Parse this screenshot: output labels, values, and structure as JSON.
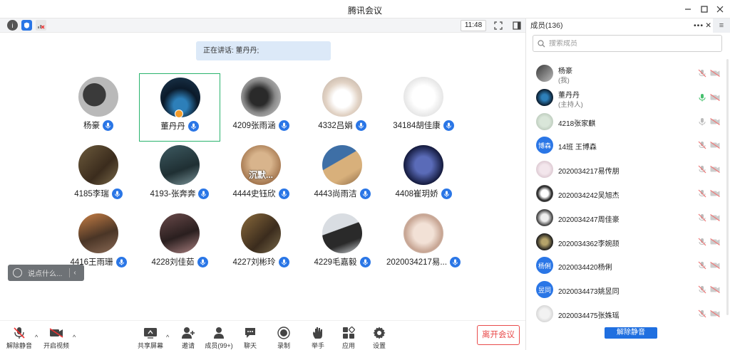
{
  "window": {
    "title": "腾讯会议"
  },
  "meeting": {
    "timer": "11:48",
    "speaking_label": "正在讲话: 董丹丹;"
  },
  "participants": [
    {
      "name": "杨豪"
    },
    {
      "name": "董丹丹"
    },
    {
      "name": "4209张雨涵"
    },
    {
      "name": "4332吕娟"
    },
    {
      "name": "34184胡佳康"
    },
    {
      "name": "4185李瑞"
    },
    {
      "name": "4193-张奔奔"
    },
    {
      "name": "4444史钰欣",
      "avatar_text": "沉默..."
    },
    {
      "name": "4443尚雨洁"
    },
    {
      "name": "4408崔玥娇"
    },
    {
      "name": "4416王雨珊"
    },
    {
      "name": "4228刘佳茹"
    },
    {
      "name": "4227刘彬玲"
    },
    {
      "name": "4229毛嘉毅"
    },
    {
      "name": "2020034217易..."
    }
  ],
  "chat": {
    "placeholder": "说点什么..."
  },
  "toolbar": {
    "unmute": "解除静音",
    "video": "开启视频",
    "share": "共享屏幕",
    "invite": "邀请",
    "members": "成员(99+)",
    "chat": "聊天",
    "record": "录制",
    "raise_hand": "举手",
    "apps": "应用",
    "settings": "设置",
    "leave": "离开会议"
  },
  "panel": {
    "title": "成员(136)",
    "search_placeholder": "搜索成员",
    "unmute_all": "解除静音",
    "members": [
      {
        "name": "杨豪",
        "role": "(我)"
      },
      {
        "name": "董丹丹",
        "role": "(主持人)"
      },
      {
        "name": "4218张家麒"
      },
      {
        "name": "14班    王博森",
        "avatar_text": "博森"
      },
      {
        "name": "2020034217易传朋"
      },
      {
        "name": "2020034242吴旭杰"
      },
      {
        "name": "2020034247周佳豪"
      },
      {
        "name": "2020034362李婉颉"
      },
      {
        "name": "2020034420杨俐",
        "avatar_text": "杨俐"
      },
      {
        "name": "2020034473姚昱同",
        "avatar_text": "昱同"
      },
      {
        "name": "2020034475张姝瑶"
      }
    ]
  },
  "colors": {
    "accent": "#1f6fe0",
    "leave": "#e94c4c",
    "active_border": "#29b36d"
  }
}
